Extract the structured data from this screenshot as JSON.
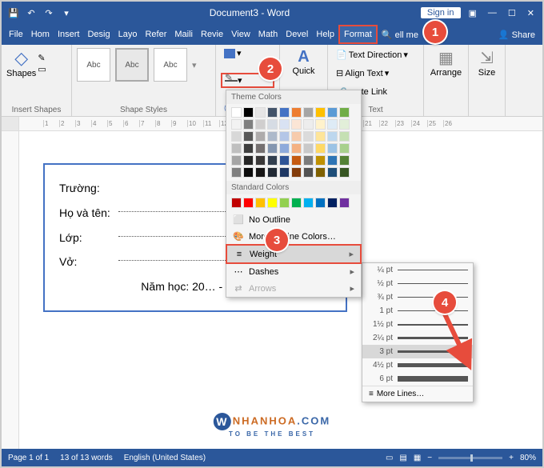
{
  "title": "Document3 - Word",
  "signin": "Sign in",
  "menu": [
    "File",
    "Hom",
    "Insert",
    "Desig",
    "Layo",
    "Refer",
    "Maili",
    "Revie",
    "View",
    "Math",
    "Devel",
    "Help",
    "Format"
  ],
  "tellme": "ell me",
  "share": "Share",
  "ribbon": {
    "insertShapes": "Insert Shapes",
    "shapes": "Shapes",
    "shapeStyles": "Shape Styles",
    "abc": "Abc",
    "quick": "Quick",
    "textDir": "Text Direction",
    "alignText": "Align Text",
    "createLink": "reate Link",
    "text": "Text",
    "arrange": "Arrange",
    "size": "Size"
  },
  "dropdown": {
    "themeColors": "Theme Colors",
    "standardColors": "Standard Colors",
    "noOutline": "No Outline",
    "moreColors": "More Outline Colors…",
    "weight": "Weight",
    "dashes": "Dashes",
    "arrows": "Arrows",
    "themeRow0": [
      "#ffffff",
      "#000000",
      "#e7e6e6",
      "#44546a",
      "#4472c4",
      "#ed7d31",
      "#a5a5a5",
      "#ffc000",
      "#5b9bd5",
      "#70ad47"
    ],
    "themeRow1": [
      "#f2f2f2",
      "#7f7f7f",
      "#d0cece",
      "#d6dce4",
      "#d9e2f3",
      "#fbe5d5",
      "#ededed",
      "#fff2cc",
      "#deebf6",
      "#e2efd9"
    ],
    "themeRow2": [
      "#d8d8d8",
      "#595959",
      "#aeabab",
      "#adb9ca",
      "#b4c6e7",
      "#f7cbac",
      "#dbdbdb",
      "#fee599",
      "#bdd7ee",
      "#c5e0b3"
    ],
    "themeRow3": [
      "#bfbfbf",
      "#3f3f3f",
      "#757070",
      "#8496b0",
      "#8eaadb",
      "#f4b183",
      "#c9c9c9",
      "#ffd965",
      "#9cc3e5",
      "#a8d08d"
    ],
    "themeRow4": [
      "#a5a5a5",
      "#262626",
      "#3a3838",
      "#323f4f",
      "#2f5496",
      "#c55a11",
      "#7b7b7b",
      "#bf9000",
      "#2e75b5",
      "#538135"
    ],
    "themeRow5": [
      "#7f7f7f",
      "#0c0c0c",
      "#171616",
      "#222a35",
      "#1f3864",
      "#833c0b",
      "#525252",
      "#7f6000",
      "#1e4e79",
      "#375623"
    ],
    "standard": [
      "#c00000",
      "#ff0000",
      "#ffc000",
      "#ffff00",
      "#92d050",
      "#00b050",
      "#00b0f0",
      "#0070c0",
      "#002060",
      "#7030a0"
    ]
  },
  "weights": {
    "items": [
      "¼ pt",
      "½ pt",
      "¾ pt",
      "1 pt",
      "1½ pt",
      "2¼ pt",
      "3 pt",
      "4½ pt",
      "6 pt"
    ],
    "px": [
      0.5,
      1,
      1,
      1.5,
      2,
      2.8,
      3.6,
      5,
      7
    ],
    "more": "More Lines…"
  },
  "doc": {
    "truong": "Trường:",
    "hoten": "Họ và tên:",
    "lop": "Lớp:",
    "vo": "Vở:",
    "namhoc": "Năm học: 20… - 20…"
  },
  "status": {
    "page": "Page 1 of 1",
    "words": "13 of 13 words",
    "lang": "English (United States)",
    "zoom": "80%"
  },
  "watermark": {
    "name": "NHANHOA",
    "dom": ".COM",
    "sub": "TO BE THE BEST"
  },
  "badges": {
    "b1": "1",
    "b2": "2",
    "b3": "3",
    "b4": "4"
  }
}
